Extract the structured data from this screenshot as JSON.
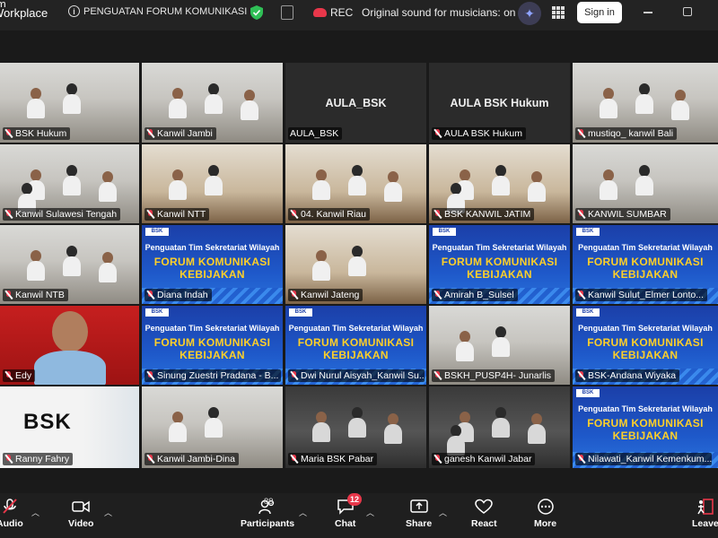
{
  "app": {
    "brand": "Workplace",
    "meeting_title": "PENGUATAN FORUM KOMUNIKASI",
    "rec_label": "REC",
    "original_sound": "Original sound for musicians: on",
    "signin_label": "Sign in"
  },
  "tiles": [
    {
      "name": "BSK Hukum",
      "muted": true,
      "scene": "room-light",
      "active": true
    },
    {
      "name": "Kanwil Jambi",
      "muted": true,
      "scene": "room-light"
    },
    {
      "name": "AULA_BSK",
      "muted": false,
      "scene": "blank",
      "center": "AULA_BSK"
    },
    {
      "name": "AULA BSK Hukum",
      "muted": true,
      "scene": "blank",
      "center": "AULA BSK Hukum"
    },
    {
      "name": "mustiqo_ kanwil Bali",
      "muted": true,
      "scene": "room-light"
    },
    {
      "name": "Kanwil Sulawesi Tengah",
      "muted": true,
      "scene": "room-light"
    },
    {
      "name": "Kanwil NTT",
      "muted": true,
      "scene": "room-wood"
    },
    {
      "name": "04. Kanwil Riau",
      "muted": true,
      "scene": "room-wood"
    },
    {
      "name": "BSK KANWIL JATIM",
      "muted": true,
      "scene": "room-wood"
    },
    {
      "name": "KANWIL SUMBAR",
      "muted": true,
      "scene": "room-light"
    },
    {
      "name": "Kanwil NTB",
      "muted": true,
      "scene": "room-light"
    },
    {
      "name": "Diana Indah",
      "muted": true,
      "scene": "banner"
    },
    {
      "name": "Kanwil Jateng",
      "muted": true,
      "scene": "room-wood"
    },
    {
      "name": "Amirah B_Sulsel",
      "muted": true,
      "scene": "banner"
    },
    {
      "name": "Kanwil Sulut_Elmer Lonto...",
      "muted": true,
      "scene": "banner"
    },
    {
      "name": "Edy",
      "muted": true,
      "scene": "portrait"
    },
    {
      "name": "Sinung Zuestri Pradana - B...",
      "muted": true,
      "scene": "banner"
    },
    {
      "name": "Dwi Nurul Aisyah_Kanwil Su...",
      "muted": true,
      "scene": "banner"
    },
    {
      "name": "BSKH_PUSP4H- Junarlis",
      "muted": true,
      "scene": "room-light"
    },
    {
      "name": "BSK-Andana Wiyaka",
      "muted": true,
      "scene": "banner"
    },
    {
      "name": "Ranny Fahry",
      "muted": true,
      "scene": "bsklogo"
    },
    {
      "name": "Kanwil Jambi-Dina",
      "muted": true,
      "scene": "room-light"
    },
    {
      "name": "Maria BSK Pabar",
      "muted": true,
      "scene": "room-dark"
    },
    {
      "name": "ganesh Kanwil Jabar",
      "muted": true,
      "scene": "room-dark"
    },
    {
      "name": "Nilawati_Kanwil Kemenkum...",
      "muted": true,
      "scene": "banner"
    }
  ],
  "banner": {
    "line1": "Penguatan Tim Sekretariat Wilayah",
    "line2": "FORUM KOMUNIKASI KEBIJAKAN",
    "logo": "BSK"
  },
  "bsk_logo_text": "BSK",
  "toolbar": {
    "audio": "Audio",
    "video": "Video",
    "participants": "Participants",
    "participants_count": "89",
    "chat": "Chat",
    "chat_badge": "12",
    "share": "Share",
    "react": "React",
    "more": "More",
    "leave": "Leave"
  },
  "colors": {
    "muted_red": "#e8374a",
    "active_speaker": "#3fbf54",
    "banner_blue": "#1e58c9",
    "banner_yellow": "#ffd028"
  }
}
